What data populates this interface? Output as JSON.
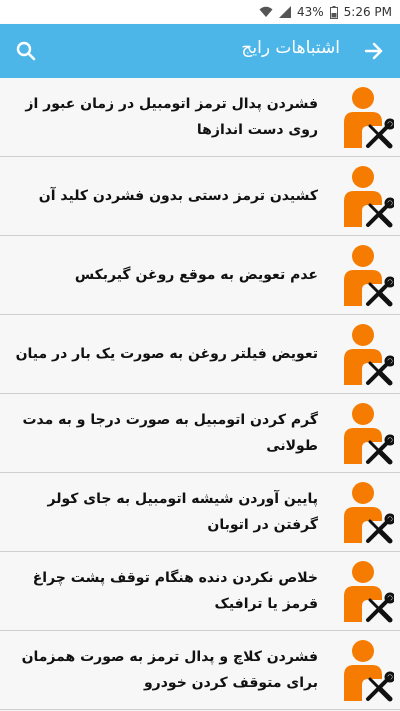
{
  "status_bar": {
    "battery_percent": "43%",
    "time": "5:26 PM"
  },
  "app_bar": {
    "title": "اشتباهات رایج",
    "color": "#4db6e8"
  },
  "icons": {
    "accent": "#f57c00",
    "person_tools": "person-with-wrench-screwdriver-icon"
  },
  "items": [
    {
      "text": "فشردن پدال ترمز اتومبیل در زمان عبور از روی دست اندازها"
    },
    {
      "text": "کشیدن ترمز دستی بدون فشردن کلید آن"
    },
    {
      "text": "عدم تعویض به موقع روغن گیربکس"
    },
    {
      "text": "تعویض فیلتر روغن به صورت یک بار در میان"
    },
    {
      "text": "گرم کردن اتومبیل به صورت درجا و به مدت طولانی"
    },
    {
      "text": "پایین آوردن شیشه اتومبیل به جای کولر گرفتن در اتوبان"
    },
    {
      "text": "خلاص نکردن دنده هنگام توقف پشت چراغ قرمز یا ترافیک"
    },
    {
      "text": "فشردن کلاچ و پدال ترمز به صورت همزمان برای متوقف کردن خودرو"
    }
  ]
}
